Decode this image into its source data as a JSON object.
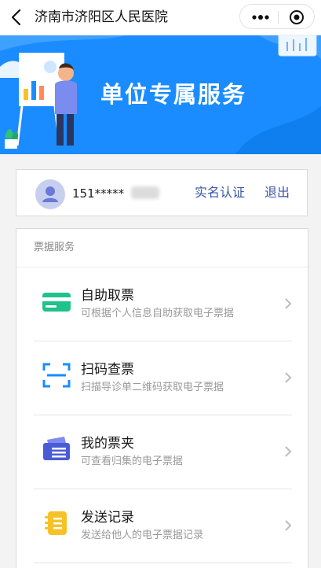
{
  "nav": {
    "title": "济南市济阳区人民医院"
  },
  "banner": {
    "title": "单位专属服务"
  },
  "user": {
    "phone": "151*****",
    "realname_link": "实名认证",
    "logout_link": "退出"
  },
  "services": {
    "section_label": "票据服务",
    "items": [
      {
        "title": "自助取票",
        "desc": "可根据个人信息自助获取电子票据",
        "icon": "ticket-card-icon",
        "color": "#1fc28b"
      },
      {
        "title": "扫码查票",
        "desc": "扫描导诊单二维码获取电子票据",
        "icon": "scan-icon",
        "color": "#1a8cff"
      },
      {
        "title": "我的票夹",
        "desc": "可查看归集的电子票据",
        "icon": "ticket-folder-icon",
        "color": "#4a5bd6"
      },
      {
        "title": "发送记录",
        "desc": "发送给他人的电子票据记录",
        "icon": "send-record-icon",
        "color": "#f6c228"
      }
    ]
  },
  "colors": {
    "brand_blue": "#1a8cff",
    "link": "#3b57a8"
  }
}
